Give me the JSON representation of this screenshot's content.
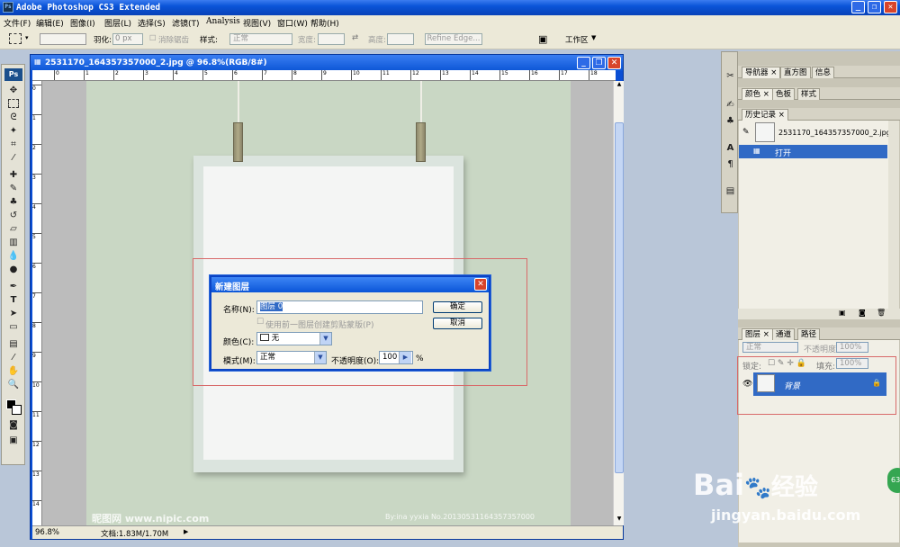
{
  "app": {
    "title": "Adobe Photoshop CS3 Extended",
    "logo": "Ps"
  },
  "menu": [
    "文件(F)",
    "编辑(E)",
    "图像(I)",
    "图层(L)",
    "选择(S)",
    "滤镜(T)",
    "Analysis",
    "视图(V)",
    "窗口(W)",
    "帮助(H)"
  ],
  "options": {
    "feather_label": "羽化:",
    "feather_value": "0 px",
    "antialias_label": "消除锯齿",
    "style_label": "样式:",
    "style_value": "正常",
    "width_label": "宽度:",
    "height_label": "高度:",
    "refine_edge": "Refine Edge...",
    "workspace": "工作区"
  },
  "document": {
    "title": "2531170_164357357000_2.jpg @ 96.8%(RGB/8#)",
    "zoom": "96.8%",
    "doc_size": "文档:1.83M/1.70M",
    "ruler_marks": [
      "0",
      "1",
      "2",
      "3",
      "4",
      "5",
      "6",
      "7",
      "8",
      "9",
      "10",
      "11",
      "12",
      "13",
      "14",
      "15",
      "16",
      "17",
      "18"
    ],
    "watermark_left": "昵图网 www.nipic.com",
    "watermark_right": "By:ina yyxia  No.20130531164357357000"
  },
  "dialog": {
    "title": "新建图层",
    "name_label": "名称(N):",
    "name_value": "图层 0",
    "clip_checkbox": "使用前一图层创建剪贴蒙版(P)",
    "color_label": "颜色(C):",
    "color_value": "无",
    "mode_label": "模式(M):",
    "mode_value": "正常",
    "opacity_label": "不透明度(O):",
    "opacity_value": "100",
    "percent": "%",
    "ok": "确定",
    "cancel": "取消"
  },
  "panels": {
    "top_tabs": [
      "导航器",
      "直方图",
      "信息"
    ],
    "mid_tabs": [
      "颜色",
      "色板",
      "样式"
    ],
    "history_tab": "历史记录",
    "history_snapshot": "2531170_164357357000_2.jpg",
    "history_step": "打开",
    "layers_tabs": [
      "图层",
      "通道",
      "路径"
    ],
    "blend_mode": "正常",
    "opacity_label": "不透明度:",
    "opacity_value": "100%",
    "lock_label": "锁定:",
    "fill_label": "填充:",
    "fill_value": "100%",
    "layer_name": "背景"
  },
  "baidu": {
    "brand": "Bai",
    "brand_cn": "经验",
    "url": "jingyan.baidu.com",
    "badge": "63"
  }
}
